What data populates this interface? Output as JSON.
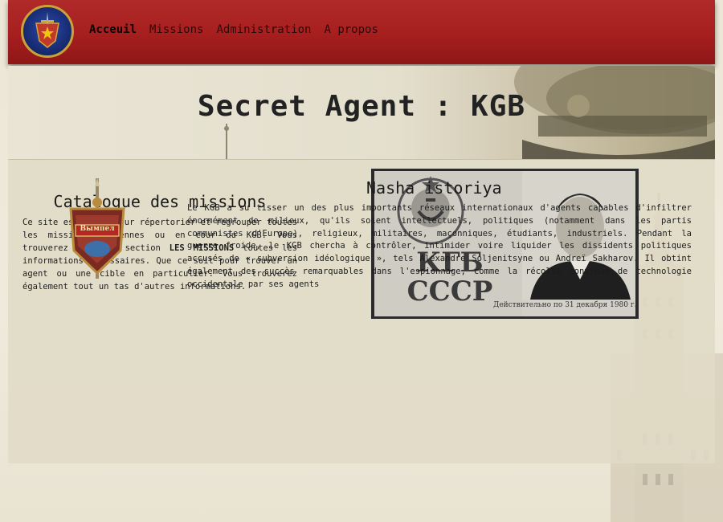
{
  "nav": {
    "links": [
      "Acceuil",
      "Missions",
      "Administration",
      "A propos"
    ],
    "active": "Acceuil"
  },
  "hero": {
    "title": "Secret Agent : KGB"
  },
  "catalog": {
    "title": "Catalogue des missions",
    "text_before": "Ce site est conçu pour répertorier et regrouper toutes les missions anciennes ou en cour du KGB. Vous trouverez dans la section ",
    "text_bold": "LES MISSIONS",
    "text_after": " toutes les informations nécessaires. Que ce soit pour trouver un agent ou une cible en particulier. Vous trouverez également tout un tas d'autres informations."
  },
  "id_card": {
    "emblem_text": "КГБ СССР",
    "caption": "Действительно по 31 декабря 1980 г."
  },
  "badge": {
    "text": "Вымпел"
  },
  "history": {
    "title": "Nasha istoriya",
    "text": "Le KGB a su tisser un des plus importants réseaux internationaux d'agents capables d'infiltrer énormément de milieux, qu'ils soient intellectuels, politiques (notamment dans les partis communistes d'Europe), religieux, militaires, maçonniques, étudiants, industriels. Pendant la guerre froide, le KGB chercha à contrôler, intimider voire liquider les dissidents politiques accusés de « subversion idéologique », tels Alexandre Soljenitsyne ou Andreï Sakharov. Il obtint également des succès remarquables dans l'espionnage, comme la récolte continue de technologie occidentale par ses agents"
  },
  "colors": {
    "navbar": "#a81f1f",
    "content_bg": "#e0dbc6",
    "page_bg": "#ece6d6"
  }
}
